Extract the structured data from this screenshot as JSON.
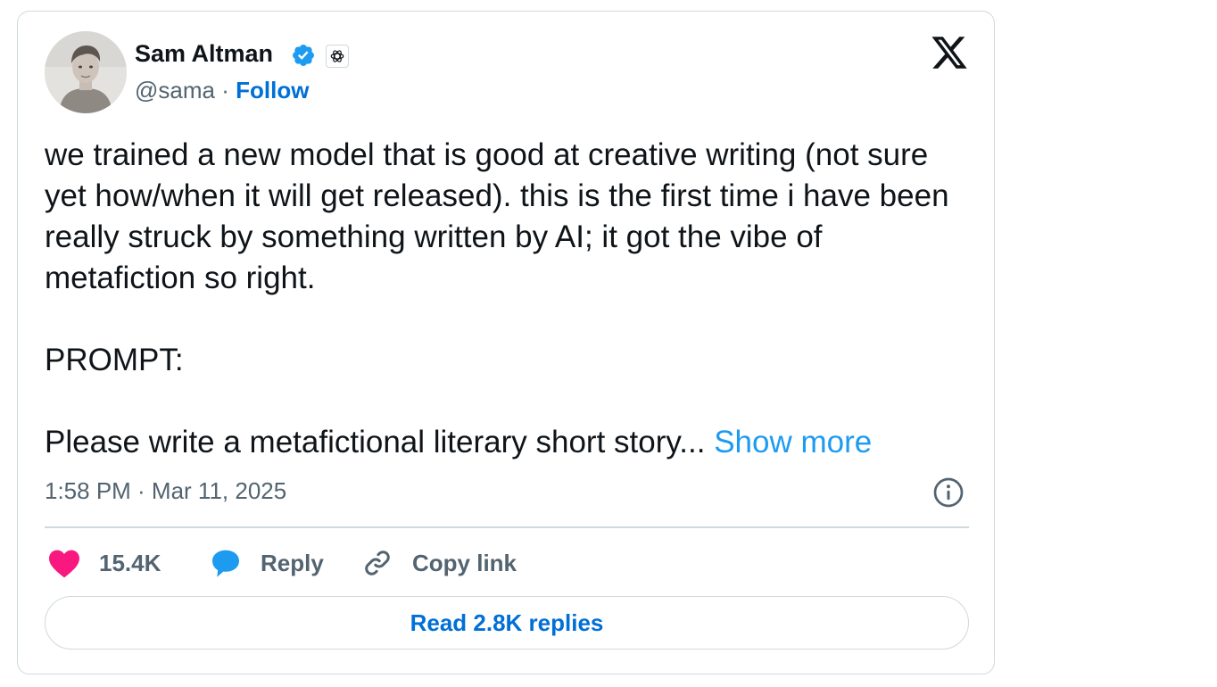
{
  "author": {
    "name": "Sam Altman",
    "handle": "@sama",
    "separator": "·",
    "follow_label": "Follow",
    "verified_icon": "verified-badge-icon",
    "affiliation_icon": "openai-logo-icon"
  },
  "platform_icon": "x-logo-icon",
  "tweet": {
    "paragraph_1": "we trained a new model that is good at creative writing (not sure yet how/when it will get released). this is the first time i have been really struck by something written by AI; it got the vibe of metafiction so right.",
    "paragraph_2": "PROMPT:",
    "paragraph_3": "Please write a metafictional literary short story...",
    "show_more_label": "Show more",
    "timestamp": "1:58 PM · Mar 11, 2025"
  },
  "actions": {
    "like_count": "15.4K",
    "reply_label": "Reply",
    "copy_link_label": "Copy link"
  },
  "read_replies_label": "Read 2.8K replies",
  "colors": {
    "text": "#0f1419",
    "secondary": "#536471",
    "link": "#006fd6",
    "accent": "#1d9bf0",
    "like": "#f91880",
    "border": "#cfd9de"
  }
}
